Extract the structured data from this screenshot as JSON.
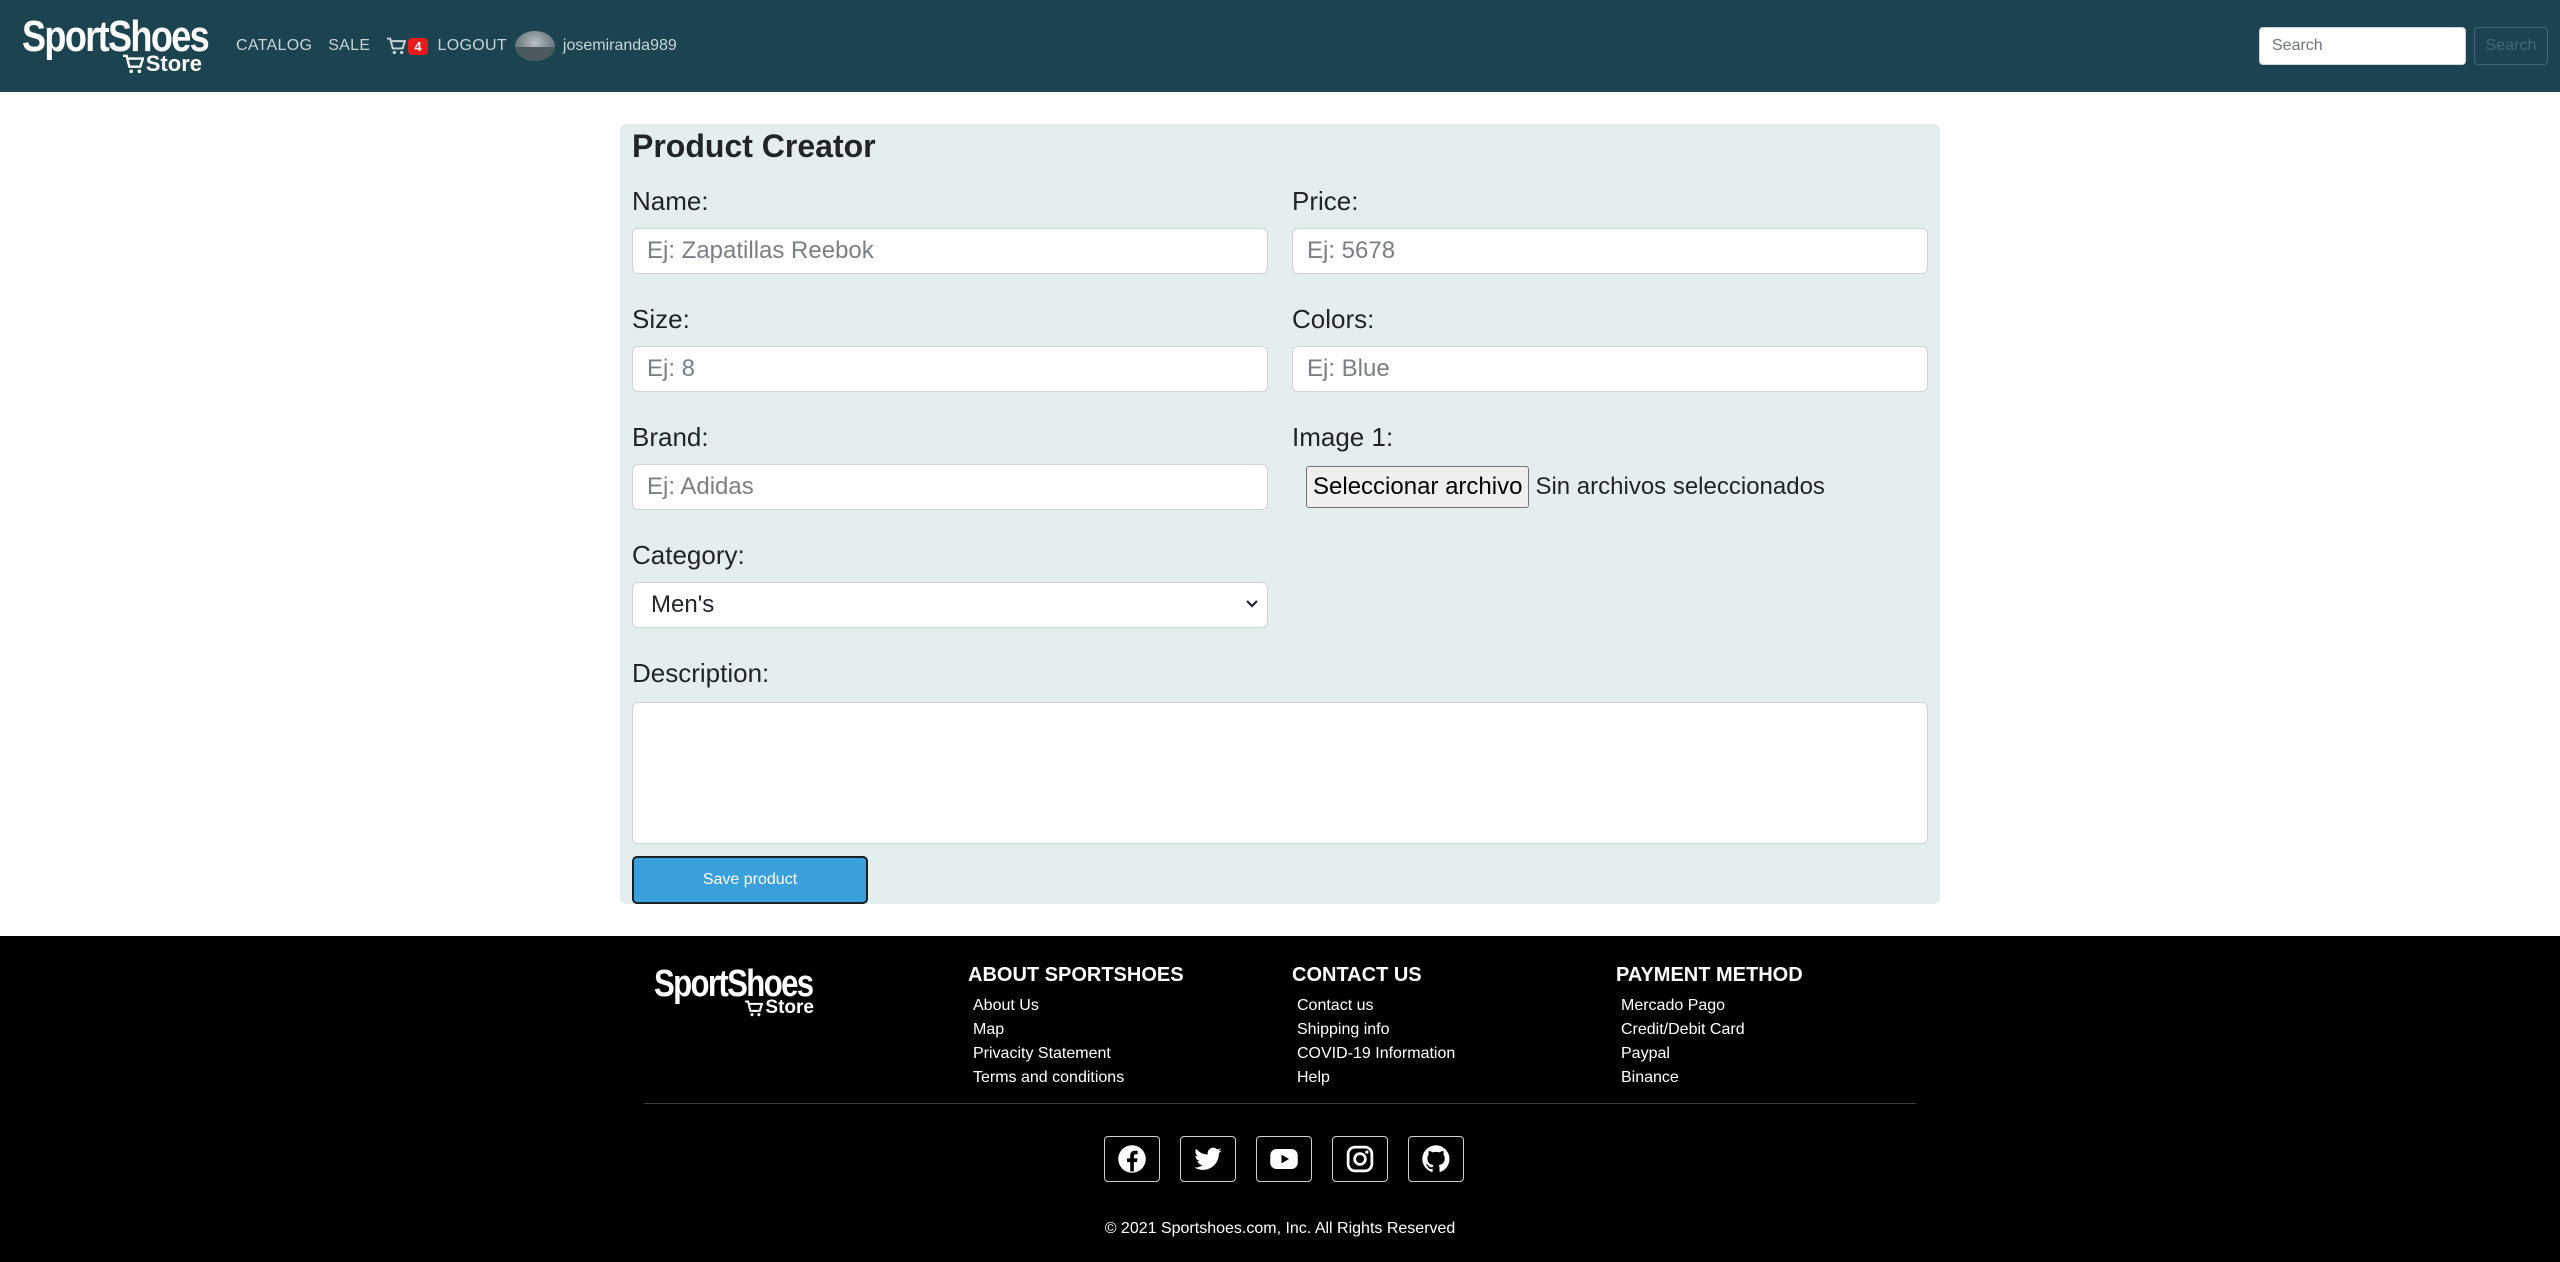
{
  "brand": {
    "logo_main": "SportShoes",
    "logo_sub": "Store"
  },
  "nav": {
    "catalog": "CATALOG",
    "sale": "SALE",
    "cart_count": "4",
    "logout": "LOGOUT",
    "username": "josemiranda989",
    "search_placeholder": "Search",
    "search_button": "Search"
  },
  "form": {
    "title": "Product Creator",
    "name_label": "Name:",
    "name_placeholder": "Ej: Zapatillas Reebok",
    "price_label": "Price:",
    "price_placeholder": "Ej: 5678",
    "size_label": "Size:",
    "size_placeholder": "Ej: 8",
    "colors_label": "Colors:",
    "colors_placeholder": "Ej: Blue",
    "brand_label": "Brand:",
    "brand_placeholder": "Ej: Adidas",
    "image_label": "Image 1:",
    "file_button": "Seleccionar archivo",
    "file_status": "Sin archivos seleccionados",
    "category_label": "Category:",
    "category_value": "Men's",
    "description_label": "Description:",
    "save_button": "Save product"
  },
  "footer": {
    "about": {
      "heading": "ABOUT SPORTSHOES",
      "items": [
        "About Us",
        "Map",
        "Privacity Statement",
        "Terms and conditions"
      ]
    },
    "contact": {
      "heading": "CONTACT US",
      "items": [
        "Contact us",
        "Shipping info",
        "COVID-19 Information",
        "Help"
      ]
    },
    "payment": {
      "heading": "PAYMENT METHOD",
      "items": [
        "Mercado Pago",
        "Credit/Debit Card",
        "Paypal",
        "Binance"
      ]
    },
    "socials": [
      "facebook-icon",
      "twitter-icon",
      "youtube-icon",
      "instagram-icon",
      "github-icon"
    ],
    "copyright": "© 2021 Sportshoes.com, Inc. All Rights Reserved"
  },
  "colors": {
    "navbar": "#1b4450",
    "card": "#e4eeef",
    "save_button": "#3aa0dc",
    "badge": "#e81b1b",
    "footer": "#000000"
  }
}
